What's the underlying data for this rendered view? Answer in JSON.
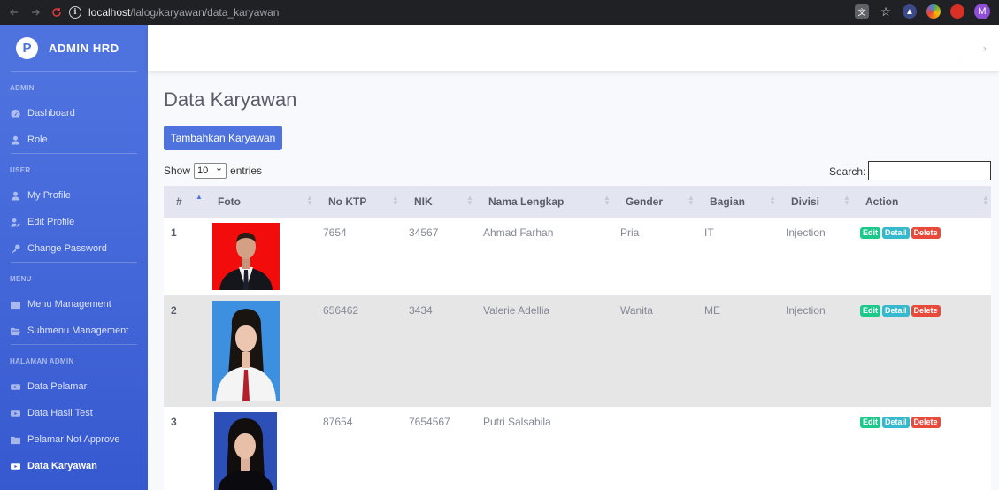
{
  "browser": {
    "url_host": "localhost",
    "url_path": "/lalog/karyawan/data_karyawan",
    "profile_initial": "M"
  },
  "sidebar": {
    "brand_logo": "P",
    "brand": "ADMIN HRD",
    "sections": [
      {
        "heading": "ADMIN",
        "items": [
          {
            "label": "Dashboard",
            "icon": "dashboard-icon"
          },
          {
            "label": "Role",
            "icon": "user-icon"
          }
        ]
      },
      {
        "heading": "USER",
        "items": [
          {
            "label": "My Profile",
            "icon": "user-icon"
          },
          {
            "label": "Edit Profile",
            "icon": "user-edit-icon"
          },
          {
            "label": "Change Password",
            "icon": "key-icon"
          }
        ]
      },
      {
        "heading": "MENU",
        "items": [
          {
            "label": "Menu Management",
            "icon": "folder-icon"
          },
          {
            "label": "Submenu Management",
            "icon": "folder-open-icon"
          }
        ]
      },
      {
        "heading": "HALAMAN ADMIN",
        "items": [
          {
            "label": "Data Pelamar",
            "icon": "youtube-icon"
          },
          {
            "label": "Data Hasil Test",
            "icon": "youtube-icon"
          },
          {
            "label": "Pelamar Not Approve",
            "icon": "folder-icon"
          },
          {
            "label": "Data Karyawan",
            "icon": "youtube-icon",
            "active": true
          }
        ]
      }
    ]
  },
  "page": {
    "title": "Data Karyawan",
    "add_button": "Tambahkan Karyawan",
    "show_label": "Show",
    "show_value": "10",
    "entries_label": "entries",
    "search_label": "Search:",
    "search_value": ""
  },
  "table": {
    "headers": [
      "#",
      "Foto",
      "No KTP",
      "NIK",
      "Nama Lengkap",
      "Gender",
      "Bagian",
      "Divisi",
      "Action"
    ],
    "rows": [
      {
        "no": "1",
        "ktp": "7654",
        "nik": "34567",
        "nama": "Ahmad Farhan",
        "gender": "Pria",
        "bagian": "IT",
        "divisi": "Injection"
      },
      {
        "no": "2",
        "ktp": "656462",
        "nik": "3434",
        "nama": "Valerie Adellia",
        "gender": "Wanita",
        "bagian": "ME",
        "divisi": "Injection"
      },
      {
        "no": "3",
        "ktp": "87654",
        "nik": "7654567",
        "nama": "Putri Salsabila",
        "gender": "",
        "bagian": "",
        "divisi": ""
      }
    ],
    "actions": {
      "edit": "Edit",
      "detail": "Detail",
      "delete": "Delete"
    }
  },
  "colors": {
    "primary": "#4e73df",
    "edit": "#1cc88a",
    "detail": "#36b9cc",
    "delete": "#e74a3b"
  }
}
